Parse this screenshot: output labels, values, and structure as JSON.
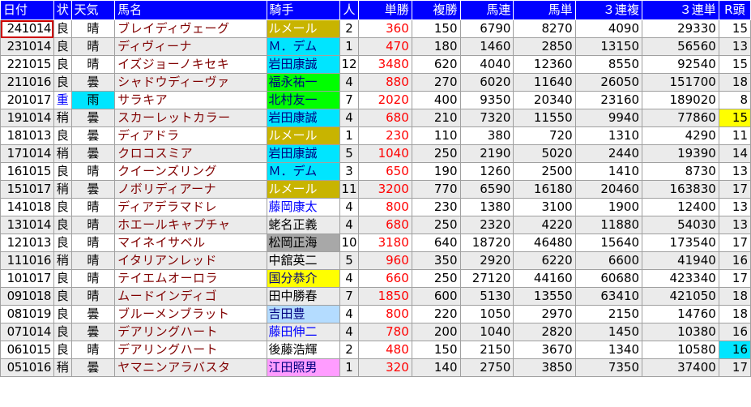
{
  "headers": {
    "date": "日付",
    "cond": "状",
    "weather": "天気",
    "horse": "馬名",
    "jockey": "騎手",
    "pop": "人",
    "win": "単勝",
    "place": "複勝",
    "quinella": "馬連",
    "exacta": "馬単",
    "trio": "３連複",
    "trifecta": "３連単",
    "heads": "R頭"
  },
  "colors": {
    "header_bg": "#0000ff",
    "horse_text": "#800000",
    "win_text": "#ff0000",
    "jockey_olive": "#c8b400",
    "jockey_cyan": "#00e5ff",
    "jockey_green": "#00ff00",
    "jockey_gray": "#a8a8a8",
    "jockey_yellow": "#ffff00",
    "jockey_lightblue": "#b4dcff",
    "jockey_pink": "#ff9cff",
    "highlight_yellow": "#ffff00",
    "highlight_cyan": "#00e5ff"
  },
  "rows": [
    {
      "date": "241014",
      "cond": "良",
      "weather": "晴",
      "horse": "ブレイディヴェーグ",
      "jockey": "ルメール",
      "pop": "2",
      "win": "360",
      "place": "150",
      "quinella": "6790",
      "exacta": "8270",
      "trio": "4090",
      "trifecta": "29330",
      "heads": "15",
      "jbg": "#c8b400",
      "jfg": "#ffffff",
      "selected": true
    },
    {
      "date": "231014",
      "cond": "良",
      "weather": "晴",
      "horse": "ディヴィーナ",
      "jockey": "Ｍ．デム",
      "pop": "1",
      "win": "470",
      "place": "180",
      "quinella": "1460",
      "exacta": "2850",
      "trio": "13150",
      "trifecta": "56560",
      "heads": "13",
      "jbg": "#00e5ff",
      "jfg": "#000080"
    },
    {
      "date": "221015",
      "cond": "良",
      "weather": "晴",
      "horse": "イズジョーノキセキ",
      "jockey": "岩田康誠",
      "pop": "12",
      "win": "3480",
      "place": "620",
      "quinella": "4040",
      "exacta": "12360",
      "trio": "8550",
      "trifecta": "92540",
      "heads": "15",
      "jbg": "#00e5ff",
      "jfg": "#000080"
    },
    {
      "date": "211016",
      "cond": "良",
      "weather": "曇",
      "horse": "シャドウディーヴァ",
      "jockey": "福永祐一",
      "pop": "4",
      "win": "880",
      "place": "270",
      "quinella": "6020",
      "exacta": "11640",
      "trio": "26050",
      "trifecta": "151700",
      "heads": "18",
      "jbg": "#00ff00",
      "jfg": "#000080"
    },
    {
      "date": "201017",
      "cond": "重",
      "weather": "雨",
      "horse": "サラキア",
      "jockey": "北村友一",
      "pop": "7",
      "win": "2020",
      "place": "400",
      "quinella": "9350",
      "exacta": "20340",
      "trio": "23160",
      "trifecta": "189020",
      "heads": "8",
      "jbg": "#00ff00",
      "jfg": "#000080",
      "condc": "#0000ff",
      "wbg": "#00e5ff"
    },
    {
      "date": "191014",
      "cond": "稍",
      "weather": "曇",
      "horse": "スカーレットカラー",
      "jockey": "岩田康誠",
      "pop": "4",
      "win": "680",
      "place": "210",
      "quinella": "7320",
      "exacta": "11550",
      "trio": "9940",
      "trifecta": "77860",
      "heads": "15",
      "jbg": "#00e5ff",
      "jfg": "#000080",
      "hbg": "#ffff00"
    },
    {
      "date": "181013",
      "cond": "良",
      "weather": "曇",
      "horse": "ディアドラ",
      "jockey": "ルメール",
      "pop": "1",
      "win": "230",
      "place": "110",
      "quinella": "380",
      "exacta": "720",
      "trio": "1310",
      "trifecta": "4290",
      "heads": "11",
      "jbg": "#c8b400",
      "jfg": "#ffffff"
    },
    {
      "date": "171014",
      "cond": "稍",
      "weather": "曇",
      "horse": "クロコスミア",
      "jockey": "岩田康誠",
      "pop": "5",
      "win": "1040",
      "place": "250",
      "quinella": "2190",
      "exacta": "5020",
      "trio": "2440",
      "trifecta": "19390",
      "heads": "14",
      "jbg": "#00e5ff",
      "jfg": "#000080"
    },
    {
      "date": "161015",
      "cond": "良",
      "weather": "晴",
      "horse": "クイーンズリング",
      "jockey": "Ｍ．デム",
      "pop": "3",
      "win": "650",
      "place": "190",
      "quinella": "1260",
      "exacta": "2500",
      "trio": "1410",
      "trifecta": "8730",
      "heads": "13",
      "jbg": "#00e5ff",
      "jfg": "#000080"
    },
    {
      "date": "151017",
      "cond": "稍",
      "weather": "曇",
      "horse": "ノボリディアーナ",
      "jockey": "ルメール",
      "pop": "11",
      "win": "3200",
      "place": "770",
      "quinella": "6590",
      "exacta": "16180",
      "trio": "20460",
      "trifecta": "163830",
      "heads": "17",
      "jbg": "#c8b400",
      "jfg": "#ffffff"
    },
    {
      "date": "141018",
      "cond": "良",
      "weather": "晴",
      "horse": "ディアデラマドレ",
      "jockey": "藤岡康太",
      "pop": "4",
      "win": "800",
      "place": "230",
      "quinella": "1380",
      "exacta": "3100",
      "trio": "1900",
      "trifecta": "12400",
      "heads": "13",
      "jbg": "",
      "jfg": "#0000ff"
    },
    {
      "date": "131014",
      "cond": "良",
      "weather": "晴",
      "horse": "ホエールキャプチャ",
      "jockey": "蛯名正義",
      "pop": "4",
      "win": "680",
      "place": "250",
      "quinella": "2320",
      "exacta": "4220",
      "trio": "11880",
      "trifecta": "54030",
      "heads": "13",
      "jbg": "",
      "jfg": "#000000"
    },
    {
      "date": "121013",
      "cond": "良",
      "weather": "晴",
      "horse": "マイネイサベル",
      "jockey": "松岡正海",
      "pop": "10",
      "win": "3180",
      "place": "640",
      "quinella": "18720",
      "exacta": "46480",
      "trio": "15640",
      "trifecta": "173540",
      "heads": "17",
      "jbg": "#a8a8a8",
      "jfg": "#000000"
    },
    {
      "date": "111016",
      "cond": "稍",
      "weather": "晴",
      "horse": "イタリアンレッド",
      "jockey": "中舘英二",
      "pop": "5",
      "win": "960",
      "place": "350",
      "quinella": "2920",
      "exacta": "6220",
      "trio": "6600",
      "trifecta": "41940",
      "heads": "16",
      "jbg": "",
      "jfg": "#000000"
    },
    {
      "date": "101017",
      "cond": "良",
      "weather": "晴",
      "horse": "テイエムオーロラ",
      "jockey": "国分恭介",
      "pop": "4",
      "win": "660",
      "place": "250",
      "quinella": "27120",
      "exacta": "44160",
      "trio": "60680",
      "trifecta": "423340",
      "heads": "17",
      "jbg": "#ffff00",
      "jfg": "#000080"
    },
    {
      "date": "091018",
      "cond": "良",
      "weather": "晴",
      "horse": "ムードインディゴ",
      "jockey": "田中勝春",
      "pop": "7",
      "win": "1850",
      "place": "600",
      "quinella": "5130",
      "exacta": "13550",
      "trio": "63410",
      "trifecta": "421050",
      "heads": "18",
      "jbg": "",
      "jfg": "#000000"
    },
    {
      "date": "081019",
      "cond": "良",
      "weather": "曇",
      "horse": "ブルーメンブラット",
      "jockey": "吉田豊",
      "pop": "4",
      "win": "800",
      "place": "220",
      "quinella": "1050",
      "exacta": "2970",
      "trio": "2150",
      "trifecta": "14760",
      "heads": "18",
      "jbg": "#b4dcff",
      "jfg": "#000080"
    },
    {
      "date": "071014",
      "cond": "良",
      "weather": "曇",
      "horse": "デアリングハート",
      "jockey": "藤田伸二",
      "pop": "4",
      "win": "780",
      "place": "200",
      "quinella": "1040",
      "exacta": "2820",
      "trio": "1450",
      "trifecta": "10380",
      "heads": "16",
      "jbg": "",
      "jfg": "#0000ff"
    },
    {
      "date": "061015",
      "cond": "良",
      "weather": "晴",
      "horse": "デアリングハート",
      "jockey": "後藤浩輝",
      "pop": "2",
      "win": "480",
      "place": "150",
      "quinella": "2150",
      "exacta": "3670",
      "trio": "1340",
      "trifecta": "10580",
      "heads": "16",
      "jbg": "",
      "jfg": "#000000",
      "hbg": "#00e5ff"
    },
    {
      "date": "051016",
      "cond": "稍",
      "weather": "曇",
      "horse": "ヤマニンアラバスタ",
      "jockey": "江田照男",
      "pop": "1",
      "win": "320",
      "place": "140",
      "quinella": "2750",
      "exacta": "3850",
      "trio": "7350",
      "trifecta": "37400",
      "heads": "17",
      "jbg": "#ff9cff",
      "jfg": "#000080"
    }
  ]
}
